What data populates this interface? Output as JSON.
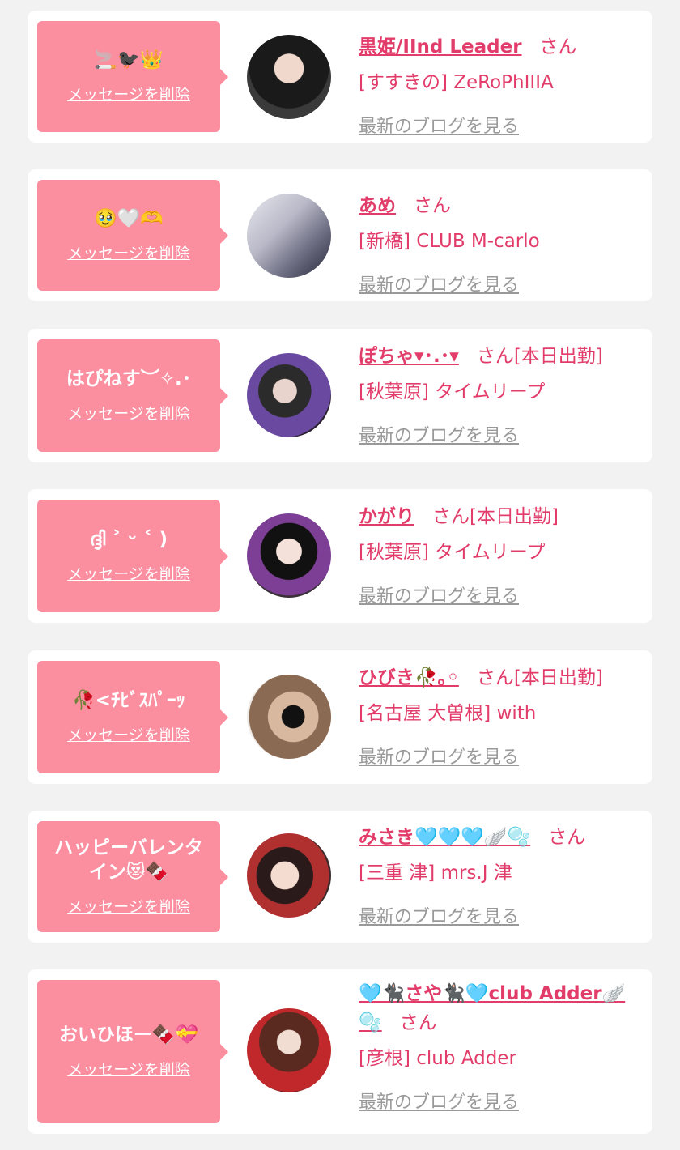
{
  "delete_label": "メッセージを削除",
  "blog_label": "最新のブログを見る",
  "honorific": "さん",
  "colors": {
    "page_bg": "#f2f2f2",
    "bubble": "#fb8fa0",
    "accent": "#e23c6a",
    "link_gray": "#999999"
  },
  "cards": [
    {
      "message": "🚬🐦‍⬛👑",
      "name": "黒姫/IInd Leader",
      "extra": "",
      "shop": "[すすきの] ZeRoPhIIIA",
      "avatar": "avatar-photo-dark-hair-girl"
    },
    {
      "message": "🥹🤍🫶",
      "name": "あめ",
      "extra": "",
      "shop": "[新橋] CLUB M-carlo",
      "avatar": "avatar-photo-room-light"
    },
    {
      "message": "はぴねす︶✧.･",
      "name": "ぽちゃ▾･.･▾",
      "extra": "[本日出勤]",
      "shop": "[秋葉原] タイムリープ",
      "avatar": "avatar-photo-purple-kimono"
    },
    {
      "message": "ദ്ദി ˃ ᵕ ˂ )",
      "name": "かがり",
      "extra": "[本日出勤]",
      "shop": "[秋葉原] タイムリープ",
      "avatar": "avatar-photo-twin-tails"
    },
    {
      "message": "🥀<ﾁﾋﾞｽﾊﾟｰｯ",
      "name": "ひびき🥀｡◦",
      "extra": "[本日出勤]",
      "shop": "[名古屋 大曽根] with",
      "avatar": "avatar-photo-mask"
    },
    {
      "message": "ハッピーバレンタイン😻🍫",
      "name": "みさき🩵🩵🩵🪽🫧",
      "extra": "",
      "shop": "[三重 津] mrs.J 津",
      "avatar": "avatar-photo-cat-ears"
    },
    {
      "message": "おいひほー🍫💝",
      "name": "🩵🐈‍⬛さや🐈‍⬛🩵club Adder🪽🫧",
      "extra": "",
      "shop": "[彦根] club Adder",
      "avatar": "avatar-photo-maid"
    }
  ]
}
